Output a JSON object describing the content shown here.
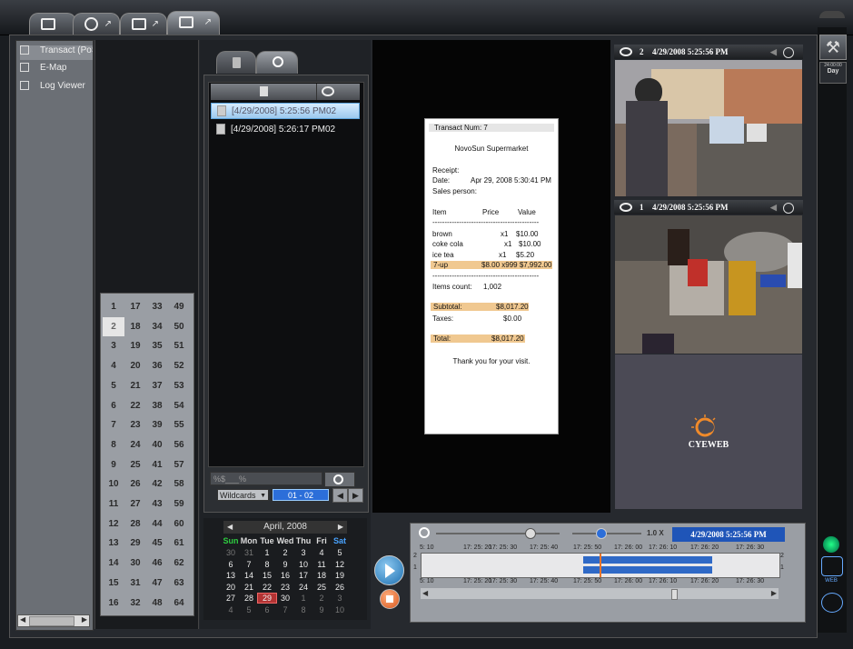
{
  "navigation": {
    "items": [
      "Transact (PoS",
      "E-Map",
      "Log Viewer"
    ]
  },
  "channels": [
    1,
    17,
    33,
    49,
    2,
    18,
    34,
    50,
    3,
    19,
    35,
    51,
    4,
    20,
    36,
    52,
    5,
    21,
    37,
    53,
    6,
    22,
    38,
    54,
    7,
    23,
    39,
    55,
    8,
    24,
    40,
    56,
    9,
    25,
    41,
    57,
    10,
    26,
    42,
    58,
    11,
    27,
    43,
    59,
    12,
    28,
    44,
    60,
    13,
    29,
    45,
    61,
    14,
    30,
    46,
    62,
    15,
    31,
    47,
    63,
    16,
    32,
    48,
    64
  ],
  "results": [
    {
      "time": "[4/29/2008] 5:25:56 PM",
      "ch": "02"
    },
    {
      "time": "[4/29/2008] 5:26:17 PM",
      "ch": "02"
    }
  ],
  "filter": {
    "value": "%$___%",
    "mode": "Wildcards",
    "range": "01 - 02"
  },
  "calendar": {
    "month": "April, 2008",
    "dow": [
      "Sun",
      "Mon",
      "Tue",
      "Wed",
      "Thu",
      "Fri",
      "Sat"
    ],
    "weeks": [
      [
        "30",
        "31",
        "1",
        "2",
        "3",
        "4",
        "5"
      ],
      [
        "6",
        "7",
        "8",
        "9",
        "10",
        "11",
        "12"
      ],
      [
        "13",
        "14",
        "15",
        "16",
        "17",
        "18",
        "19"
      ],
      [
        "20",
        "21",
        "22",
        "23",
        "24",
        "25",
        "26"
      ],
      [
        "27",
        "28",
        "29",
        "30",
        "1",
        "2",
        "3"
      ],
      [
        "4",
        "5",
        "6",
        "7",
        "8",
        "9",
        "10"
      ]
    ]
  },
  "receipt": {
    "transact": "Transact Num: 7",
    "store": "NovoSun Supermarket",
    "receipt_label": "Receipt:",
    "date_label": "Date:",
    "date_value": "Apr 29, 2008 5:30:41 PM",
    "sales_label": "Sales person:",
    "col_item": "Item",
    "col_price": "Price",
    "col_value": "Value",
    "dash1": "--------------------------------------------",
    "lines": [
      {
        "item": "brown",
        "qty": "x1",
        "price": "$10.00"
      },
      {
        "item": "coke cola",
        "qty": "x1",
        "price": "$10.00"
      },
      {
        "item": "ice tea",
        "qty": "x1",
        "price": "$5.20"
      }
    ],
    "highlight": "7-up",
    "highlight_value": "$8.00 x999 $7,992.00",
    "dash2": "--------------------------------------------",
    "count_label": "Items count:",
    "count_value": "1,002",
    "subtotal_label": "Subtotal:",
    "subtotal_value": "$8,017.20",
    "taxes_label": "Taxes:",
    "taxes_value": "$0.00",
    "total_label": "Total:",
    "total_value": "$8,017.20",
    "thanks": "Thank you for your visit."
  },
  "cameras": [
    {
      "num": "2",
      "time": "4/29/2008 5:25:56 PM"
    },
    {
      "num": "1",
      "time": "4/29/2008 5:25:56 PM"
    }
  ],
  "logo": "CYEWEB",
  "timeline": {
    "speed": "1.0 X",
    "current": "4/29/2008 5:25:56 PM",
    "ticks": [
      "5: 10",
      "17: 25: 20",
      "17: 25: 30",
      "17: 25: 40",
      "17: 25: 50",
      "17: 26: 00",
      "17: 26: 10",
      "17: 26: 20",
      "17: 26: 30"
    ],
    "row_labels": [
      "2",
      "1"
    ]
  },
  "right_panel": {
    "clock": "24:00:00",
    "day": "Day"
  },
  "colors": {
    "accent": "#2c6ed9",
    "highlight": "#f0c890",
    "selected_day": "#b33333"
  }
}
